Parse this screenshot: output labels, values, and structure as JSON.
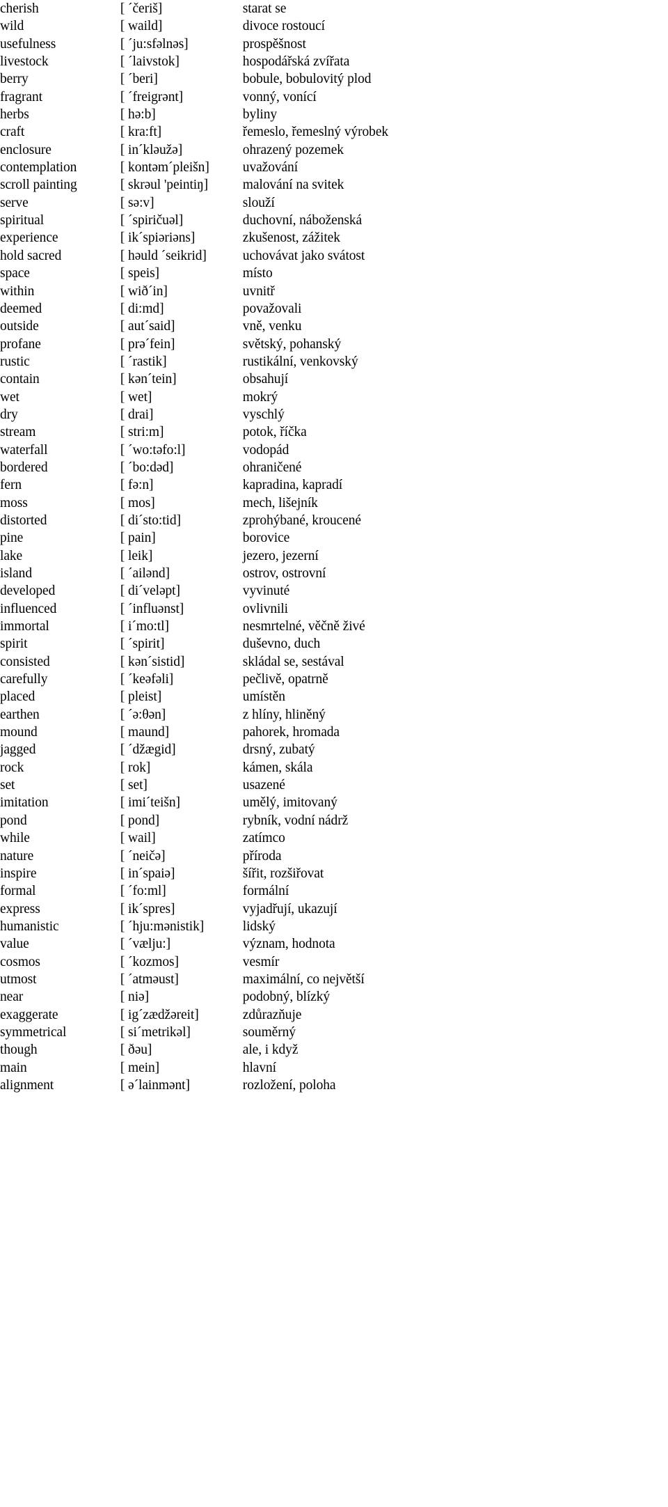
{
  "document": {
    "type": "vocabulary-glossary",
    "columns": [
      "word",
      "phonetic",
      "translation"
    ],
    "source_language": "English",
    "target_language": "Czech"
  },
  "entries": [
    {
      "word": "cherish",
      "phonetic": "[ ˊčeriš]",
      "translation": "starat se"
    },
    {
      "word": "wild",
      "phonetic": "[ waild]",
      "translation": "divoce rostoucí"
    },
    {
      "word": "usefulness",
      "phonetic": "[ ˊju:sfəlnəs]",
      "translation": "prospěšnost"
    },
    {
      "word": "livestock",
      "phonetic": "[ ˊlaivstok]",
      "translation": "hospodářská zvířata"
    },
    {
      "word": "berry",
      "phonetic": "[ ˊberi]",
      "translation": "bobule, bobulovitý plod"
    },
    {
      "word": "fragrant",
      "phonetic": "[ ˊfreigrənt]",
      "translation": "vonný, vonící"
    },
    {
      "word": "herbs",
      "phonetic": "[ hə:b]",
      "translation": "byliny"
    },
    {
      "word": "craft",
      "phonetic": "[ kra:ft]",
      "translation": "řemeslo, řemeslný výrobek"
    },
    {
      "word": "enclosure",
      "phonetic": "[ inˊkləužə]",
      "translation": "ohrazený pozemek"
    },
    {
      "word": "contemplation",
      "phonetic": "[ kontəmˊpleišn]",
      "translation": "uvažování"
    },
    {
      "word": "scroll painting",
      "phonetic": "[ skrəul 'peintiŋ]",
      "translation": "malování na svitek"
    },
    {
      "word": "serve",
      "phonetic": "[ sə:v]",
      "translation": "slouží"
    },
    {
      "word": "spiritual",
      "phonetic": "[ ˊspiričuəl]",
      "translation": "duchovní, náboženská"
    },
    {
      "word": "experience",
      "phonetic": "[ ikˊspiəriəns]",
      "translation": "zkušenost, zážitek"
    },
    {
      "word": "hold sacred",
      "phonetic": "[ həuld ˊseikrid]",
      "translation": "uchovávat jako svátost"
    },
    {
      "word": "space",
      "phonetic": "[ speis]",
      "translation": "místo"
    },
    {
      "word": "within",
      "phonetic": "[ wiðˊin]",
      "translation": "uvnitř"
    },
    {
      "word": "deemed",
      "phonetic": "[ di:md]",
      "translation": "považovali"
    },
    {
      "word": "outside",
      "phonetic": "[ autˊsaid]",
      "translation": "vně, venku"
    },
    {
      "word": "profane",
      "phonetic": "[ prəˊfein]",
      "translation": "světský, pohanský"
    },
    {
      "word": "rustic",
      "phonetic": "[ ˊrastik]",
      "translation": "rustikální, venkovský"
    },
    {
      "word": "contain",
      "phonetic": "[ kənˊtein]",
      "translation": "obsahují"
    },
    {
      "word": "wet",
      "phonetic": "[ wet]",
      "translation": "mokrý"
    },
    {
      "word": "dry",
      "phonetic": "[ drai]",
      "translation": "vyschlý"
    },
    {
      "word": "stream",
      "phonetic": "[ stri:m]",
      "translation": "potok, říčka"
    },
    {
      "word": "waterfall",
      "phonetic": "[ ˊwo:təfo:l]",
      "translation": "vodopád"
    },
    {
      "word": "bordered",
      "phonetic": "[ ˊbo:dəd]",
      "translation": "ohraničené"
    },
    {
      "word": "fern",
      "phonetic": "[ fə:n]",
      "translation": "kapradina, kapradí"
    },
    {
      "word": "moss",
      "phonetic": "[ mos]",
      "translation": "mech, lišejník"
    },
    {
      "word": "distorted",
      "phonetic": "[ diˊsto:tid]",
      "translation": "zprohýbané, kroucené"
    },
    {
      "word": "pine",
      "phonetic": "[ pain]",
      "translation": "borovice"
    },
    {
      "word": "lake",
      "phonetic": "[ leik]",
      "translation": "jezero, jezerní"
    },
    {
      "word": "island",
      "phonetic": "[ ˊailənd]",
      "translation": "ostrov, ostrovní"
    },
    {
      "word": "developed",
      "phonetic": "[ diˊveləpt]",
      "translation": "vyvinuté"
    },
    {
      "word": "influenced",
      "phonetic": "[ ˊinfluənst]",
      "translation": "ovlivnili"
    },
    {
      "word": "immortal",
      "phonetic": "[ iˊmo:tl]",
      "translation": "nesmrtelné, věčně živé"
    },
    {
      "word": "spirit",
      "phonetic": "[ ˊspirit]",
      "translation": "duševno, duch"
    },
    {
      "word": "consisted",
      "phonetic": "[ kənˊsistid]",
      "translation": "skládal se, sestával"
    },
    {
      "word": "carefully",
      "phonetic": "[ ˊkeəfəli]",
      "translation": "pečlivě, opatrně"
    },
    {
      "word": "placed",
      "phonetic": "[ pleist]",
      "translation": "umístěn"
    },
    {
      "word": "earthen",
      "phonetic": "[ ˊə:θən]",
      "translation": "z hlíny, hliněný"
    },
    {
      "word": "mound",
      "phonetic": "[ maund]",
      "translation": "pahorek, hromada"
    },
    {
      "word": "jagged",
      "phonetic": "[ ˊdžægid]",
      "translation": "drsný, zubatý"
    },
    {
      "word": "rock",
      "phonetic": "[ rok]",
      "translation": "kámen, skála"
    },
    {
      "word": "set",
      "phonetic": "[ set]",
      "translation": "usazené"
    },
    {
      "word": "imitation",
      "phonetic": "[ imiˊteišn]",
      "translation": "umělý, imitovaný"
    },
    {
      "word": "pond",
      "phonetic": "[ pond]",
      "translation": "rybník, vodní nádrž"
    },
    {
      "word": "while",
      "phonetic": "[ wail]",
      "translation": "zatímco"
    },
    {
      "word": "nature",
      "phonetic": "[ ˊneičə]",
      "translation": "příroda"
    },
    {
      "word": "inspire",
      "phonetic": "[ inˊspaiə]",
      "translation": "šířit, rozšiřovat"
    },
    {
      "word": "formal",
      "phonetic": "[ ˊfo:ml]",
      "translation": "formální"
    },
    {
      "word": "express",
      "phonetic": "[ ikˊspres]",
      "translation": "vyjadřují, ukazují"
    },
    {
      "word": "humanistic",
      "phonetic": "[ ˊhju:mənistik]",
      "translation": "lidský"
    },
    {
      "word": "value",
      "phonetic": "[ ˊvælju:]",
      "translation": "význam, hodnota"
    },
    {
      "word": "cosmos",
      "phonetic": "[ ˊkozmos]",
      "translation": "vesmír"
    },
    {
      "word": "utmost",
      "phonetic": "[ ˊatməust]",
      "translation": "maximální, co největší"
    },
    {
      "word": "near",
      "phonetic": "[ niə]",
      "translation": "podobný, blízký"
    },
    {
      "word": "exaggerate",
      "phonetic": "[ igˊzædžəreit]",
      "translation": "zdůrazňuje"
    },
    {
      "word": "symmetrical",
      "phonetic": "[ siˊmetrikəl]",
      "translation": "souměrný"
    },
    {
      "word": "though",
      "phonetic": "[ ðəu]",
      "translation": "ale, i když"
    },
    {
      "word": "main",
      "phonetic": "[ mein]",
      "translation": "hlavní"
    },
    {
      "word": "alignment",
      "phonetic": "[ əˊlainmənt]",
      "translation": "rozložení, poloha"
    }
  ]
}
